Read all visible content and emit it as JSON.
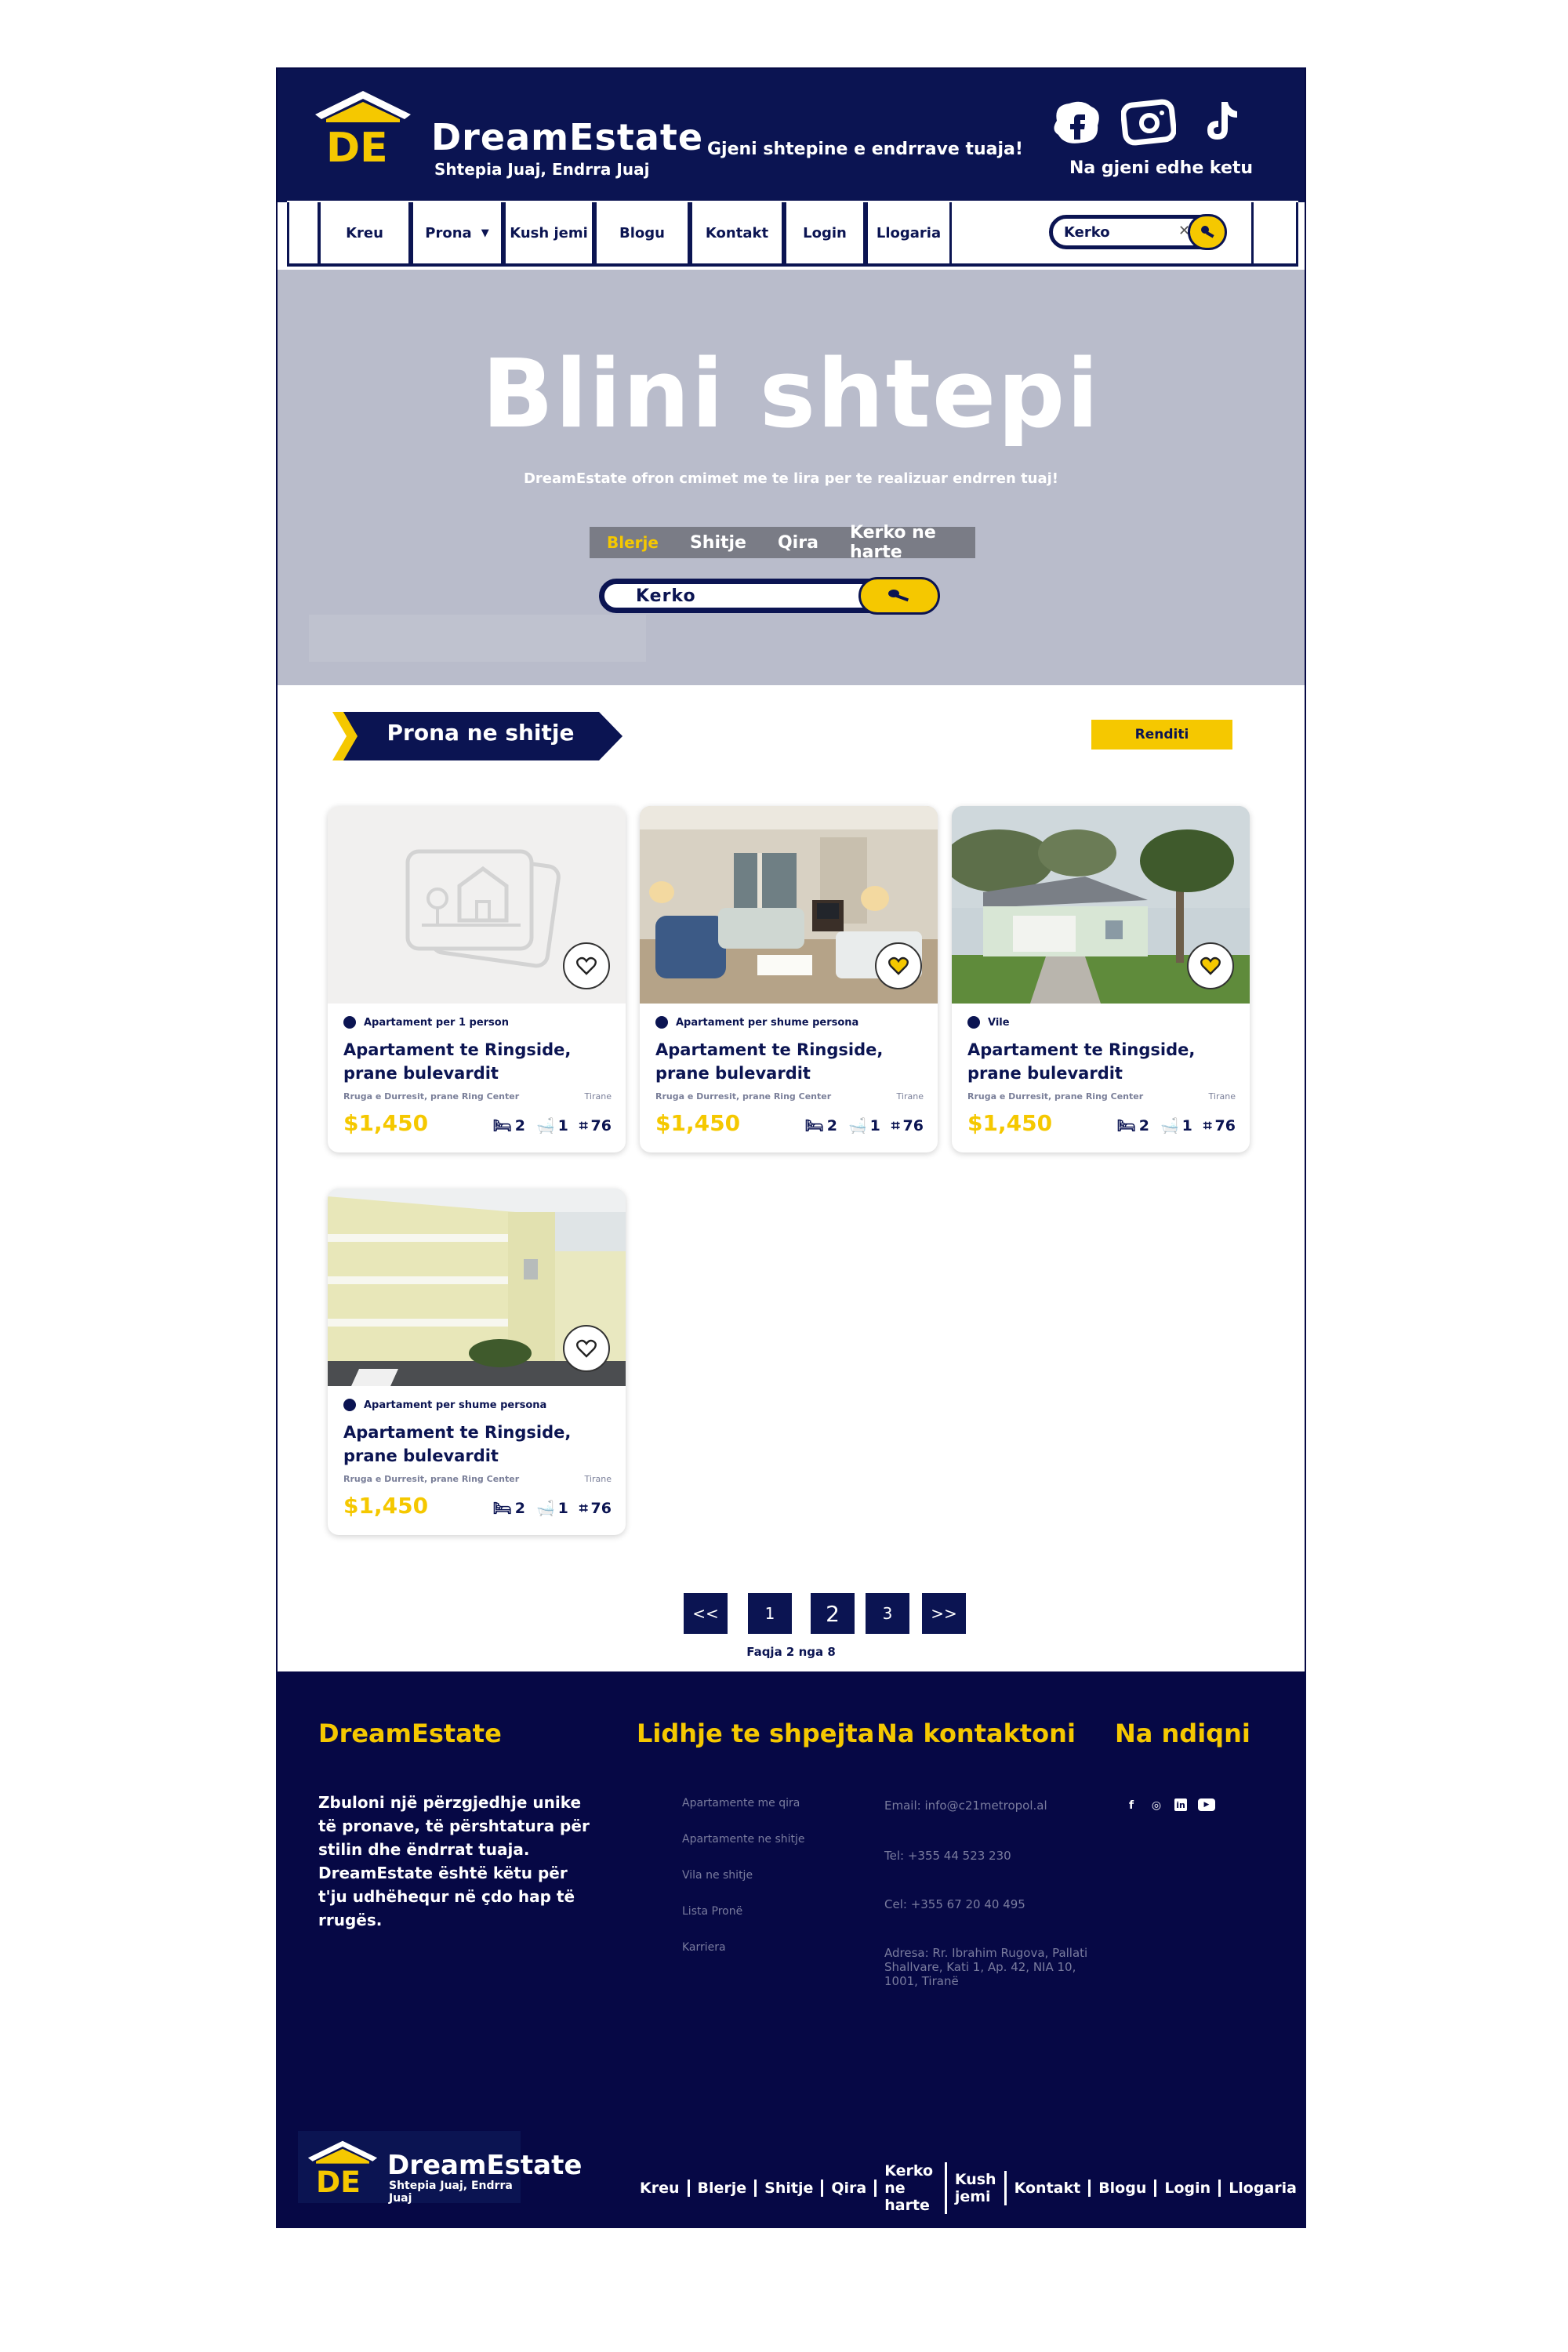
{
  "header": {
    "logo_initials": "DE",
    "brand": "DreamEstate",
    "brand_sub": "Shtepia Juaj, Endrra Juaj",
    "tagline": "Gjeni shtepine e endrrave tuaja!",
    "social_caption": "Na gjeni edhe ketu",
    "social_icons": [
      "facebook-icon",
      "instagram-icon",
      "tiktok-icon"
    ]
  },
  "nav": {
    "items": [
      "Kreu",
      "Prona",
      "Kush jemi",
      "Blogu",
      "Kontakt",
      "Login",
      "Llogaria"
    ],
    "search_text": "Kerko"
  },
  "hero": {
    "title": "Blini shtepi",
    "subtitle": "DreamEstate ofron cmimet me te lira per te realizuar endrren tuaj!",
    "tabs": [
      "Blerje",
      "Shitje",
      "Qira",
      "Kerko ne harte"
    ],
    "active_tab": "Blerje",
    "search_text": "Kerko"
  },
  "section": {
    "title": "Prona ne shitje",
    "sort_label": "Renditi"
  },
  "listings": [
    {
      "type": "Apartament per 1 person",
      "title": "Apartament te Ringside, prane bulevardit",
      "address": "Rruga e Durresit, prane Ring Center",
      "city": "Tirane",
      "price": "$1,450",
      "beds": "2",
      "baths": "1",
      "area": "76",
      "favorited": false
    },
    {
      "type": "Apartament per shume persona",
      "title": "Apartament te Ringside, prane bulevardit",
      "address": "Rruga e Durresit, prane Ring Center",
      "city": "Tirane",
      "price": "$1,450",
      "beds": "2",
      "baths": "1",
      "area": "76",
      "favorited": true
    },
    {
      "type": "Vile",
      "title": "Apartament te Ringside, prane bulevardit",
      "address": "Rruga e Durresit, prane Ring Center",
      "city": "Tirane",
      "price": "$1,450",
      "beds": "2",
      "baths": "1",
      "area": "76",
      "favorited": true
    },
    {
      "type": "Apartament per shume persona",
      "title": "Apartament te Ringside, prane bulevardit",
      "address": "Rruga e Durresit, prane Ring Center",
      "city": "Tirane",
      "price": "$1,450",
      "beds": "2",
      "baths": "1",
      "area": "76",
      "favorited": false
    }
  ],
  "pagination": {
    "prev": "<<",
    "pages": [
      "1",
      "2",
      "3"
    ],
    "current": "2",
    "next": ">>",
    "caption": "Faqja 2 nga 8"
  },
  "footer": {
    "brand": "DreamEstate",
    "about": "Zbuloni një përzgjedhje unike të pronave, të përshtatura për stilin dhe ëndrrat tuaja. DreamEstate është këtu për t'ju udhëhequr në çdo hap të rrugës.",
    "links_title": "Lidhje te shpejta",
    "links": [
      "Apartamente me qira",
      "Apartamente ne shitje",
      "Vila ne shitje",
      "Lista Pronë",
      "Karriera"
    ],
    "contact_title": "Na kontaktoni",
    "contact": {
      "email": "Email: info@c21metropol.al",
      "tel": "Tel: +355 44 523 230",
      "cel": "Cel: +355 67 20 40 495",
      "address": "Adresa: Rr. Ibrahim Rugova, Pallati Shallvare, Kati 1, Ap. 42, NIA 10, 1001, Tiranë"
    },
    "follow_title": "Na ndiqni",
    "follow_icons": [
      "facebook-icon",
      "instagram-icon",
      "linkedin-icon",
      "youtube-icon"
    ],
    "logo_initials": "DE",
    "logo_brand": "DreamEstate",
    "logo_sub": "Shtepia Juaj, Endrra Juaj",
    "nav": [
      "Kreu",
      "Blerje",
      "Shitje",
      "Qira",
      "Kerko ne harte",
      "Kush jemi",
      "Kontakt",
      "Blogu",
      "Login",
      "Llogaria"
    ]
  },
  "colors": {
    "navy": "#0b1452",
    "footer_navy": "#060845",
    "accent_yellow": "#f5c800",
    "hero_gray": "#b9bccb"
  }
}
